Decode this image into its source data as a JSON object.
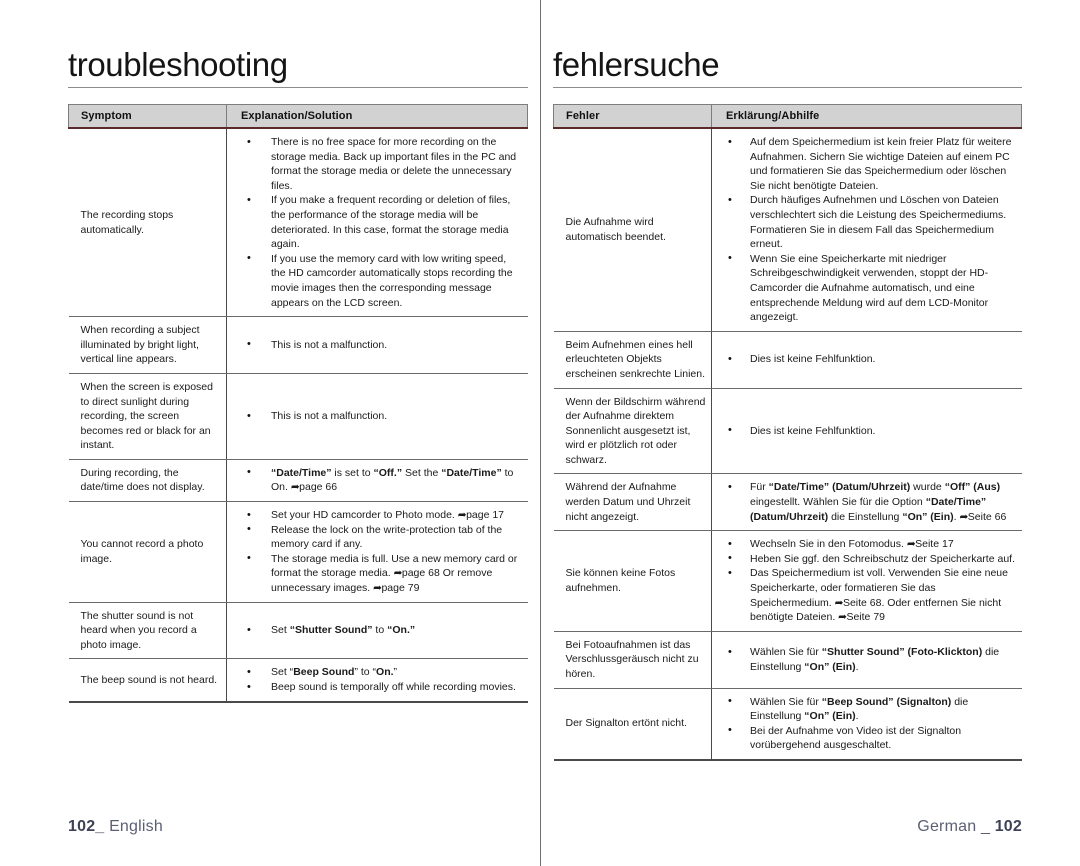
{
  "left_page": {
    "title": "troubleshooting",
    "table": {
      "headers": [
        "Symptom",
        "Explanation/Solution"
      ],
      "rows": [
        {
          "symptom": "The recording stops automatically.",
          "items": [
            "There is no free space for more recording on the storage media. Back up important files in the PC and format the storage media or delete the unnecessary files.",
            "If you make a frequent recording or deletion of files, the performance of the storage media will be deteriorated. In this case, format the storage media again.",
            "If you use the memory card with low writing speed, the HD camcorder automatically stops recording the movie images then the corresponding message appears on the LCD screen."
          ]
        },
        {
          "symptom": "When recording a subject illuminated by bright light, vertical line appears.",
          "items": [
            "This is not a malfunction."
          ]
        },
        {
          "symptom": "When the screen is exposed to direct sunlight during recording, the screen becomes red or black for an instant.",
          "items": [
            "This is not a malfunction."
          ]
        },
        {
          "symptom": "During recording, the date/time does not display.",
          "items_html": [
            "<b>&ldquo;Date/Time&rdquo;</b> is set to <b>&ldquo;Off.&rdquo;</b> Set the <b>&ldquo;Date/Time&rdquo;</b> to On. <span class=\"arr\">&#10150;</span>page 66"
          ]
        },
        {
          "symptom": "You cannot record a photo image.",
          "items_html": [
            "Set your HD camcorder to Photo mode. <span class=\"arr\">&#10150;</span>page 17",
            "Release the lock on the write-protection tab of the memory card if any.",
            "The storage media is full. Use a new memory card or format the storage media. <span class=\"arr\">&#10150;</span>page 68 Or remove unnecessary images. <span class=\"arr\">&#10150;</span>page 79"
          ]
        },
        {
          "symptom": "The shutter sound is not heard when you record a photo image.",
          "items_html": [
            "Set <b>&ldquo;Shutter Sound&rdquo;</b> to <b>&ldquo;On.&rdquo;</b>"
          ]
        },
        {
          "symptom": "The beep sound is not heard.",
          "items_html": [
            "Set &ldquo;<b>Beep Sound</b>&rdquo; to &ldquo;<b>On.</b>&rdquo;",
            "Beep sound is temporally off while recording movies."
          ]
        }
      ]
    },
    "footer": {
      "page_number": "102_",
      "language": "English"
    }
  },
  "right_page": {
    "title": "fehlersuche",
    "table": {
      "headers": [
        "Fehler",
        "Erklärung/Abhilfe"
      ],
      "rows": [
        {
          "symptom": "Die Aufnahme wird automatisch beendet.",
          "items": [
            "Auf dem Speichermedium ist kein freier Platz für weitere Aufnahmen. Sichern Sie wichtige Dateien auf einem PC und formatieren Sie das Speichermedium oder löschen Sie nicht benötigte Dateien.",
            "Durch häufiges Aufnehmen und Löschen von Dateien verschlechtert sich die Leistung des Speichermediums. Formatieren Sie in diesem Fall das Speichermedium erneut.",
            "Wenn Sie eine Speicherkarte mit niedriger Schreibgeschwindigkeit verwenden, stoppt der HD-Camcorder die Aufnahme automatisch, und eine entsprechende Meldung wird auf dem LCD-Monitor angezeigt."
          ]
        },
        {
          "symptom": "Beim Aufnehmen eines hell erleuchteten Objekts erscheinen senkrechte Linien.",
          "items": [
            "Dies ist keine Fehlfunktion."
          ]
        },
        {
          "symptom": "Wenn der Bildschirm während der Aufnahme direktem Sonnenlicht ausgesetzt ist, wird er plötzlich rot oder schwarz.",
          "items": [
            "Dies ist keine Fehlfunktion."
          ]
        },
        {
          "symptom": "Während der Aufnahme werden Datum und Uhrzeit nicht angezeigt.",
          "items_html": [
            "Für <b>&ldquo;Date/Time&rdquo; (Datum/Uhrzeit)</b> wurde <b>&ldquo;Off&rdquo; (Aus)</b> eingestellt. Wählen Sie für die Option <b>&ldquo;Date/Time&rdquo; (Datum/Uhrzeit)</b> die Einstellung <b>&ldquo;On&rdquo; (Ein)</b>. <span class=\"arr\">&#10150;</span>Seite 66"
          ]
        },
        {
          "symptom": "Sie können keine Fotos aufnehmen.",
          "items_html": [
            "Wechseln Sie in den Fotomodus. <span class=\"arr\">&#10150;</span>Seite 17",
            "Heben Sie ggf. den Schreibschutz der Speicherkarte auf.",
            "Das Speichermedium ist voll. Verwenden Sie eine neue Speicherkarte, oder formatieren Sie das Speichermedium. <span class=\"arr\">&#10150;</span>Seite 68. Oder entfernen Sie nicht benötigte Dateien. <span class=\"arr\">&#10150;</span>Seite 79"
          ]
        },
        {
          "symptom": "Bei Fotoaufnahmen ist das Verschlussgeräusch nicht zu hören.",
          "items_html": [
            "Wählen Sie für <b>&ldquo;Shutter Sound&rdquo; (Foto-Klickton)</b> die Einstellung <b>&ldquo;On&rdquo; (Ein)</b>."
          ]
        },
        {
          "symptom": "Der Signalton ertönt nicht.",
          "items_html": [
            "Wählen Sie für <b>&ldquo;Beep Sound&rdquo; (Signalton)</b> die Einstellung <b>&ldquo;On&rdquo; (Ein)</b>.",
            "Bei der Aufnahme von Video ist der Signalton vorübergehend ausgeschaltet."
          ]
        }
      ]
    },
    "footer": {
      "language": "German _",
      "page_number": "102"
    }
  },
  "colors": {
    "header_bg": "#d2d2d2",
    "header_rule": "#5a2a2a",
    "grid": "#6a6a6a",
    "footer_text": "#5b5f74",
    "text": "#1a1a1a"
  }
}
